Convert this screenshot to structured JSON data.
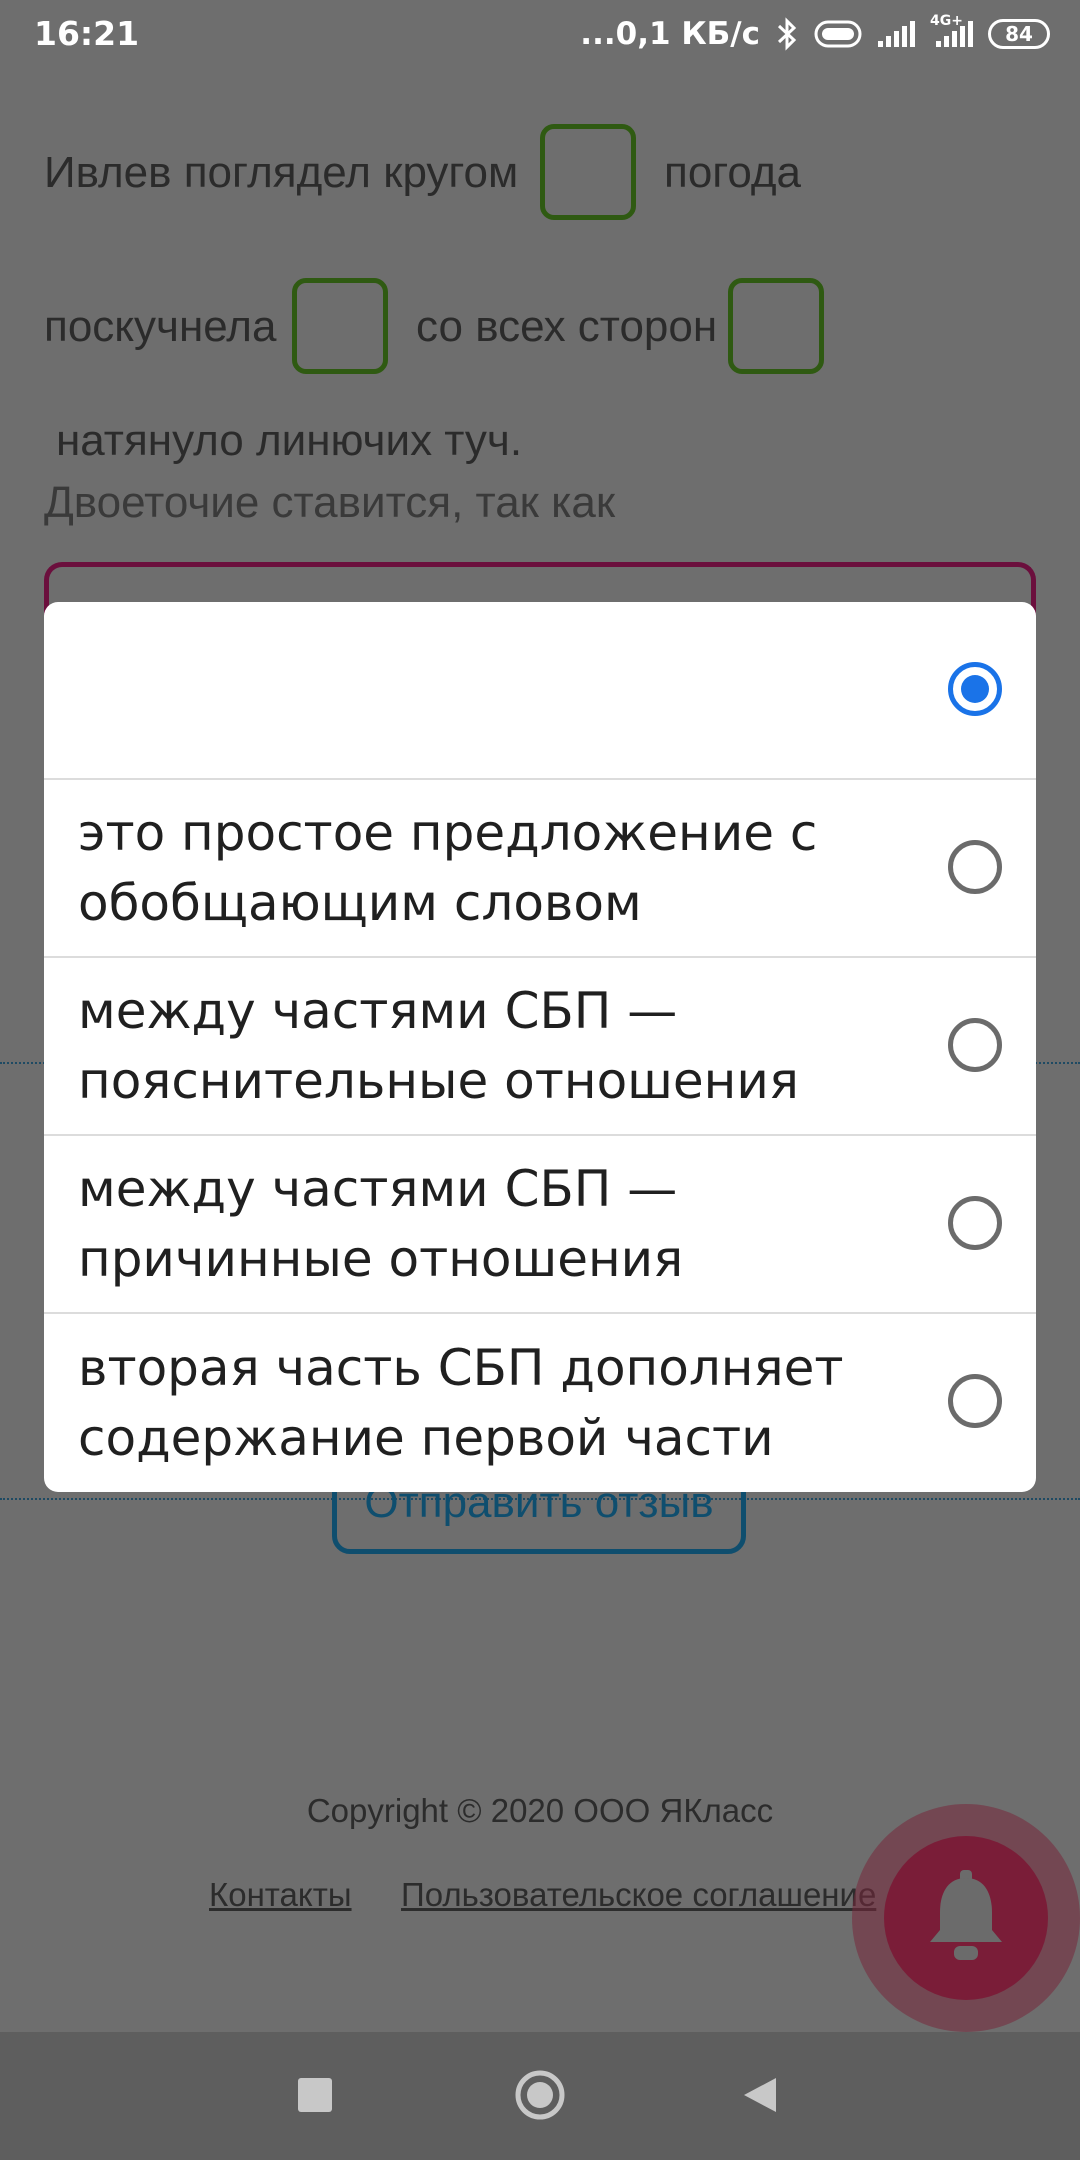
{
  "status_bar": {
    "time": "16:21",
    "speed": "...0,1 КБ/с",
    "network_label": "4G+",
    "battery": "84"
  },
  "exercise": {
    "line1_text": "Ивлев поглядел кругом",
    "line1_after": "погода",
    "line2_text": "поскучнела",
    "line2_middle": "со всех сторон",
    "line3_text": "натянуло линючих туч.",
    "hint": "Двоеточие ставится, так как"
  },
  "feedback_button": "Отправить отзыв",
  "footer": {
    "copyright": "Copyright © 2020 ООО ЯКласс",
    "link_contacts": "Контакты",
    "link_agreement": "Пользовательское соглашение"
  },
  "dialog": {
    "options": [
      {
        "label": "",
        "selected": true
      },
      {
        "label": "это простое предложение с обобщающим словом",
        "selected": false
      },
      {
        "label": "между частями СБП — пояснительные отношения",
        "selected": false
      },
      {
        "label": "между частями СБП — причинные отношения",
        "selected": false
      },
      {
        "label": "вторая часть СБП дополняет содержание первой части",
        "selected": false
      }
    ]
  },
  "colors": {
    "radio_selected": "#1a73e8",
    "gap_border": "#2f5a12",
    "answer_field_border": "#6b0f3d",
    "feedback_border": "#0f4e6e"
  }
}
